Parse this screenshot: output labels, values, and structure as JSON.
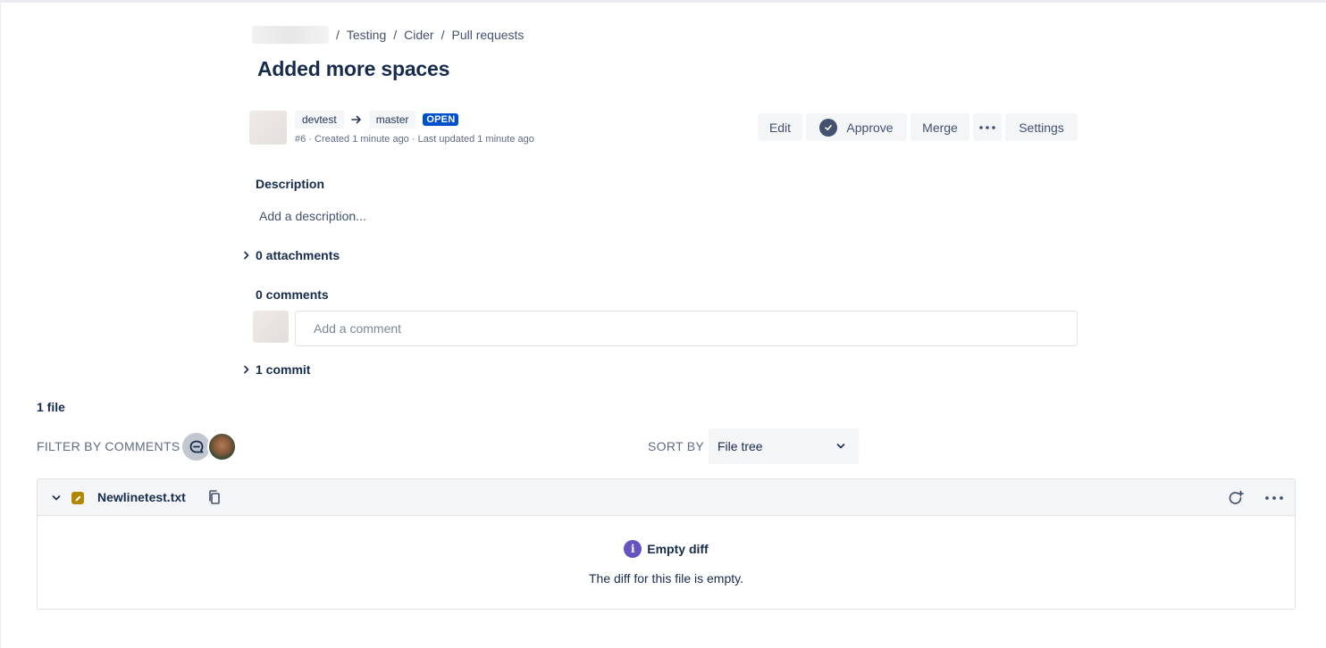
{
  "breadcrumb": {
    "items": [
      "Testing",
      "Cider",
      "Pull requests"
    ],
    "separator": "/"
  },
  "pull_request": {
    "title": "Added more spaces",
    "source_branch": "devtest",
    "target_branch": "master",
    "status": "OPEN",
    "meta": "#6 · Created 1 minute ago · Last updated 1 minute ago"
  },
  "actions": {
    "edit": "Edit",
    "approve": "Approve",
    "merge": "Merge",
    "more": "•••",
    "settings": "Settings"
  },
  "description": {
    "label": "Description",
    "placeholder": "Add a description..."
  },
  "attachments": {
    "label": "0 attachments"
  },
  "comments": {
    "label": "0 comments",
    "placeholder": "Add a comment"
  },
  "commits": {
    "label": "1 commit"
  },
  "files": {
    "count_label": "1 file",
    "filter_label": "FILTER BY COMMENTS",
    "sort_label": "SORT BY",
    "sort_value": "File tree",
    "list": [
      {
        "name": "Newlinetest.txt",
        "status": "modified",
        "empty_title": "Empty diff",
        "empty_desc": "The diff for this file is empty."
      }
    ]
  },
  "colors": {
    "primary_text": "#172B4D",
    "secondary_text": "#42526E",
    "subtle_text": "#5E6C84",
    "open_lozenge": "#0052CC",
    "button_bg": "#F4F5F7",
    "modified_icon": "#B38600",
    "info_icon": "#6554C0"
  }
}
